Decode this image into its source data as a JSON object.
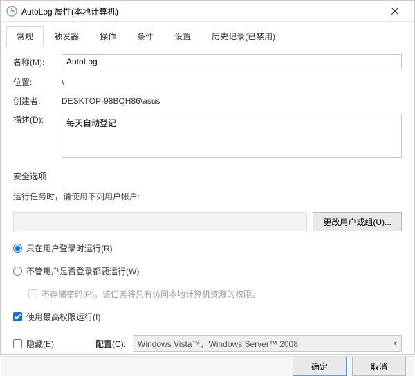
{
  "window": {
    "title": "AutoLog 属性(本地计算机)"
  },
  "tabs": [
    "常规",
    "触发器",
    "操作",
    "条件",
    "设置",
    "历史记录(已禁用)"
  ],
  "activeTab": 0,
  "general": {
    "nameLabel": "名称(M):",
    "name": "AutoLog",
    "locationLabel": "位置:",
    "location": "\\",
    "creatorLabel": "创建者:",
    "creator": "DESKTOP-98BQH86\\asus",
    "descLabel": "描述(D):",
    "desc": "每天自动登记"
  },
  "security": {
    "title": "安全选项",
    "runAsLabel": "运行任务时，请使用下列用户帐户:",
    "user": "",
    "changeUserBtn": "更改用户或组(U)...",
    "radioLoggedOn": "只在用户登录时运行(R)",
    "radioAnyTime": "不管用户是否登录都要运行(W)",
    "noStorePwd": "不存储密码(P)。该任务将只有访问本地计算机资源的权限。",
    "highestPriv": "使用最高权限运行(I)"
  },
  "config": {
    "hiddenLabel": "隐藏(E)",
    "configLabel": "配置(C):",
    "configValue": "Windows Vista™、Windows Server™ 2008"
  },
  "footer": {
    "ok": "确定",
    "cancel": "取消"
  }
}
